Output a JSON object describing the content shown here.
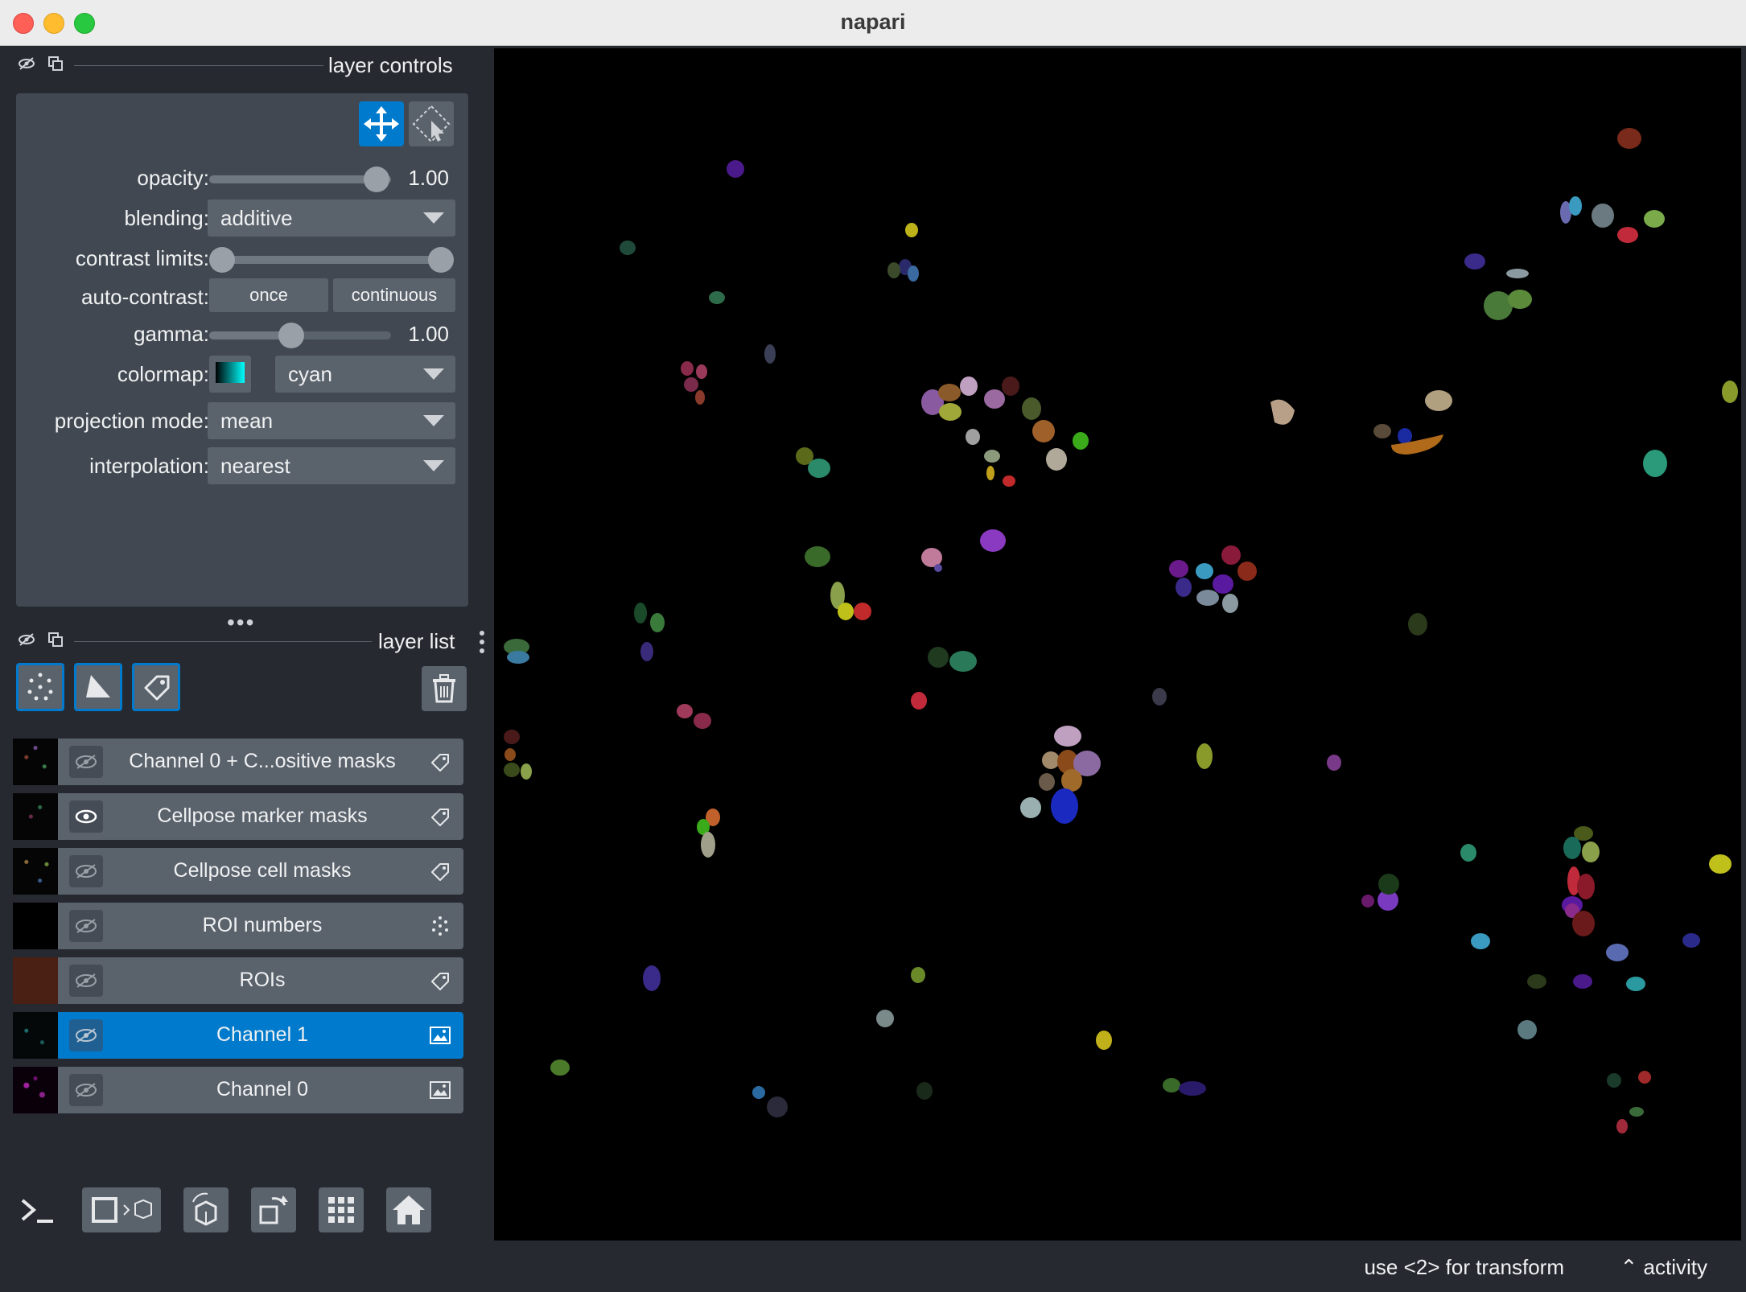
{
  "window": {
    "title": "napari"
  },
  "layer_controls": {
    "header": "layer controls",
    "opacity": {
      "label": "opacity:",
      "value": "1.00",
      "level": 1.0
    },
    "blending": {
      "label": "blending:",
      "value": "additive"
    },
    "contrast_limits": {
      "label": "contrast limits:",
      "low": 0.0,
      "high": 1.0
    },
    "auto_contrast": {
      "label": "auto-contrast:",
      "once": "once",
      "continuous": "continuous"
    },
    "gamma": {
      "label": "gamma:",
      "value": "1.00",
      "level": 0.5
    },
    "colormap": {
      "label": "colormap:",
      "value": "cyan",
      "swatch_start": "#000000",
      "swatch_end": "#00ffff"
    },
    "projection_mode": {
      "label": "projection mode:",
      "value": "mean"
    },
    "interpolation": {
      "label": "interpolation:",
      "value": "nearest"
    }
  },
  "layer_list": {
    "header": "layer list",
    "layers": [
      {
        "name": "Channel 0 + C...ositive masks",
        "type": "labels",
        "visible": false,
        "selected": false
      },
      {
        "name": "Cellpose marker masks",
        "type": "labels",
        "visible": true,
        "selected": false
      },
      {
        "name": "Cellpose cell masks",
        "type": "labels",
        "visible": false,
        "selected": false
      },
      {
        "name": "ROI numbers",
        "type": "points",
        "visible": false,
        "selected": false
      },
      {
        "name": "ROIs",
        "type": "labels",
        "visible": false,
        "selected": false
      },
      {
        "name": "Channel 1",
        "type": "image",
        "visible": false,
        "selected": true
      },
      {
        "name": "Channel 0",
        "type": "image",
        "visible": false,
        "selected": false
      }
    ]
  },
  "bottom_toolbar": [
    "console-icon",
    "ndisplay-toggle-icon",
    "roll-dims-icon",
    "transpose-dims-icon",
    "grid-view-icon",
    "home-icon"
  ],
  "status": {
    "hint": "use <2> for transform",
    "activity": "activity"
  },
  "colors": {
    "accent": "#007acc",
    "panel": "#414851",
    "background": "#262930"
  }
}
